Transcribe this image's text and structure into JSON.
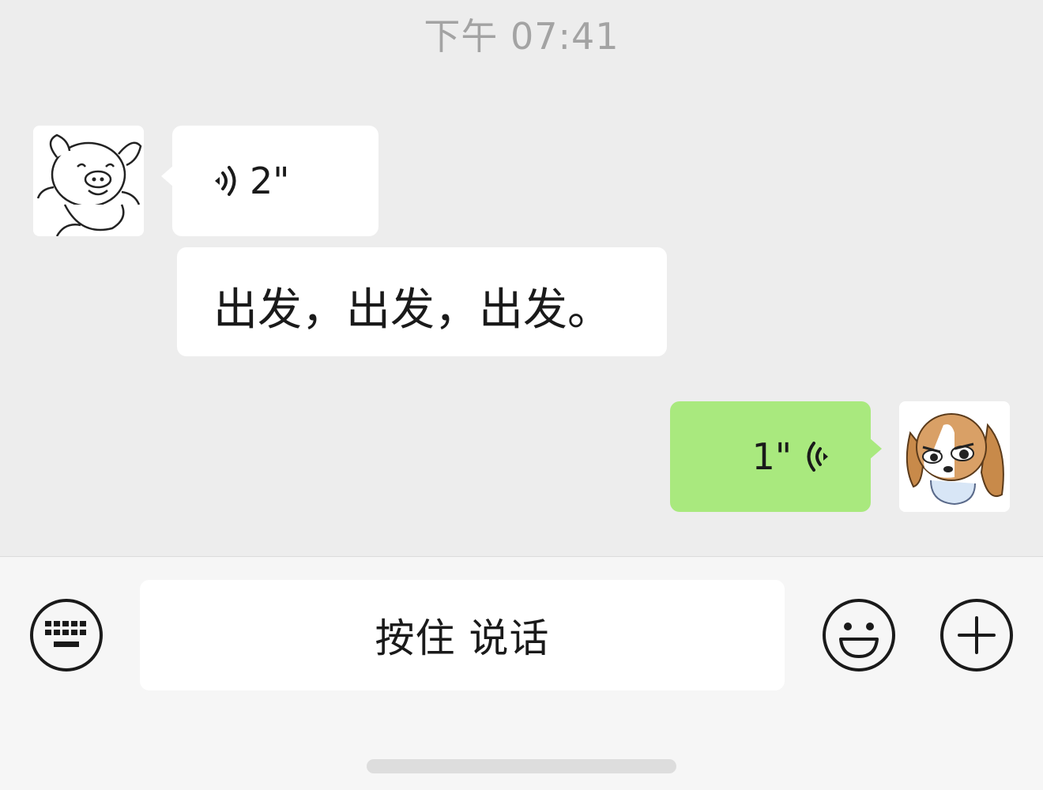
{
  "chat": {
    "timestamp": "下午 07:41",
    "messages": [
      {
        "sender": "other",
        "type": "voice",
        "duration": "2\"",
        "avatar": "pig-avatar"
      },
      {
        "sender": "other",
        "type": "text",
        "text": "出发，出发，出发。"
      },
      {
        "sender": "self",
        "type": "voice",
        "duration": "1\"",
        "avatar": "dog-avatar"
      }
    ]
  },
  "input_bar": {
    "keyboard_icon": "keyboard-icon",
    "hold_to_talk_label": "按住 说话",
    "emoji_icon": "emoji-icon",
    "plus_icon": "plus-icon"
  },
  "colors": {
    "background": "#ededed",
    "self_bubble": "#a9e97e",
    "other_bubble": "#ffffff",
    "timestamp_text": "#a3a3a3",
    "bottom_bar": "#f6f6f6"
  }
}
